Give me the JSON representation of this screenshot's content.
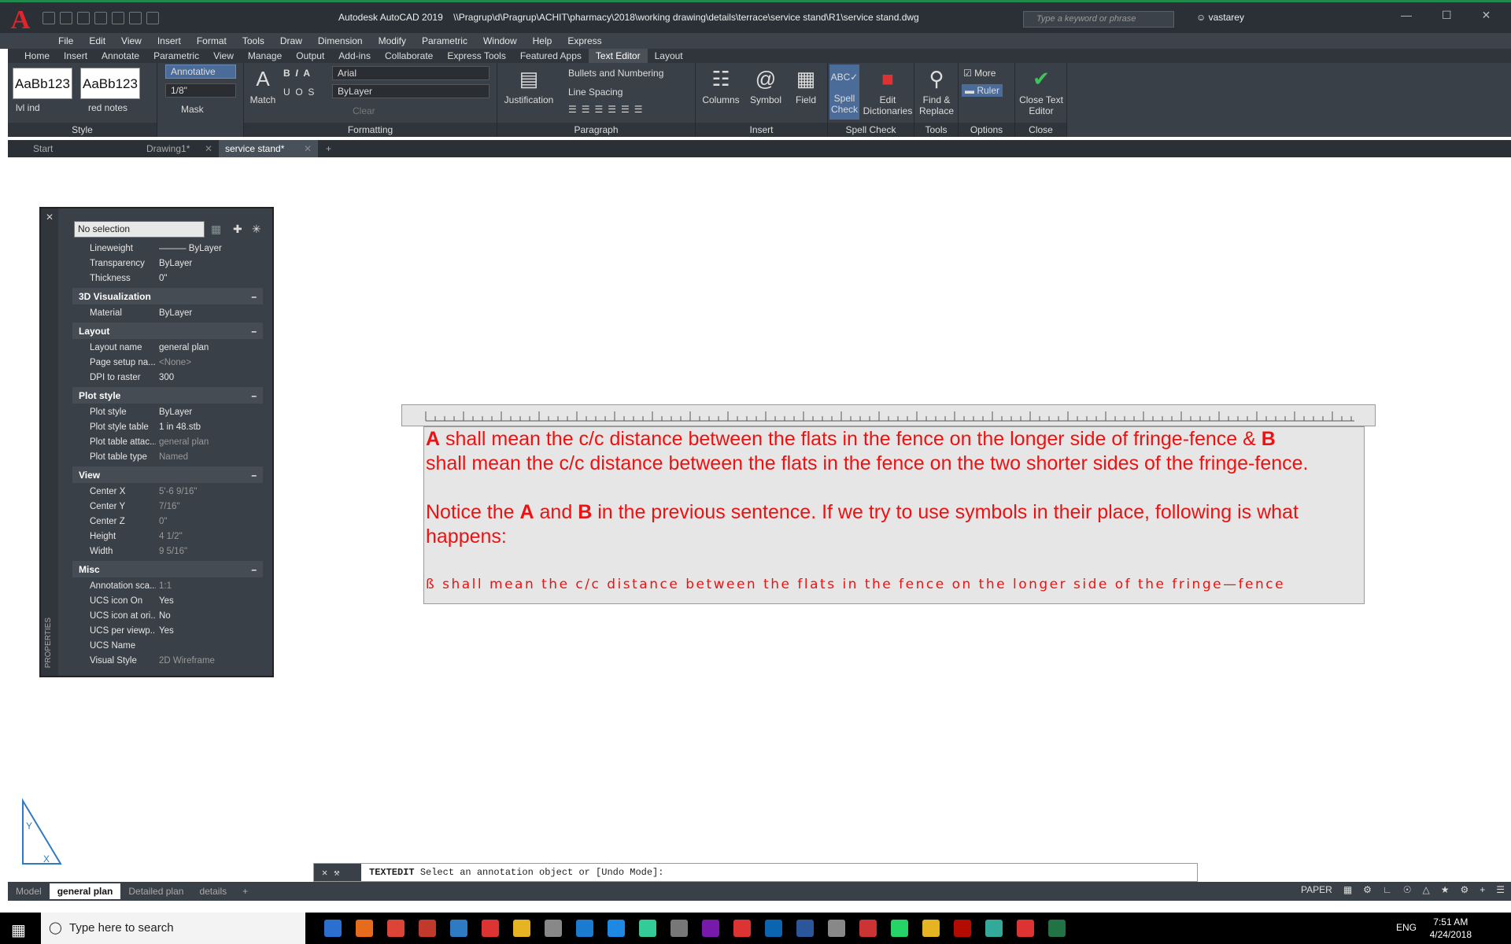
{
  "app": {
    "name": "Autodesk AutoCAD 2019",
    "file_path": "\\\\Pragrup\\d\\Pragrup\\ACHIT\\pharmacy\\2018\\working drawing\\details\\terrace\\service stand\\R1\\service stand.dwg",
    "search_placeholder": "Type a keyword or phrase",
    "user": "vastarey"
  },
  "menu": [
    "File",
    "Edit",
    "View",
    "Insert",
    "Format",
    "Tools",
    "Draw",
    "Dimension",
    "Modify",
    "Parametric",
    "Window",
    "Help",
    "Express"
  ],
  "ribbon_tabs": [
    "Home",
    "Insert",
    "Annotate",
    "Parametric",
    "View",
    "Manage",
    "Output",
    "Add-ins",
    "Collaborate",
    "Express Tools",
    "Featured Apps",
    "Text Editor",
    "Layout"
  ],
  "ribbon_active_tab": "Text Editor",
  "ribbon": {
    "style_panel": {
      "title": "Style",
      "swatch1": "AaBb123",
      "swatch1_label": "lvl ind",
      "swatch2": "AaBb123",
      "swatch2_label": "red notes",
      "annotative": "Annotative",
      "height": "1/8\"",
      "mask": "Mask"
    },
    "formatting_panel": {
      "title": "Formatting",
      "match": "Match",
      "font": "Arial",
      "color": "ByLayer",
      "clear": "Clear"
    },
    "paragraph_panel": {
      "title": "Paragraph",
      "justification": "Justification",
      "bullets": "Bullets and Numbering",
      "line_spacing": "Line Spacing"
    },
    "insert_panel": {
      "title": "Insert",
      "columns": "Columns",
      "symbol": "Symbol",
      "field": "Field"
    },
    "spell_panel": {
      "title": "Spell Check",
      "spell": "Spell Check",
      "edit_dict": "Edit Dictionaries"
    },
    "tools_panel": {
      "title": "Tools",
      "find": "Find & Replace"
    },
    "options_panel": {
      "title": "Options",
      "more": "More",
      "ruler": "Ruler"
    },
    "close_panel": {
      "title": "Close",
      "close": "Close Text Editor"
    }
  },
  "doc_tabs": [
    "Start",
    "Drawing1*",
    "service stand*"
  ],
  "properties": {
    "selection": "No selection",
    "strip_title": "PROPERTIES",
    "rows_top": [
      {
        "k": "Lineweight",
        "v": "——— ByLayer"
      },
      {
        "k": "Transparency",
        "v": "ByLayer"
      },
      {
        "k": "Thickness",
        "v": "0\""
      }
    ],
    "sections": [
      {
        "title": "3D Visualization",
        "rows": [
          {
            "k": "Material",
            "v": "ByLayer"
          }
        ]
      },
      {
        "title": "Layout",
        "rows": [
          {
            "k": "Layout name",
            "v": "general plan"
          },
          {
            "k": "Page setup na...",
            "v": "<None>"
          },
          {
            "k": "DPI to raster",
            "v": "300"
          }
        ]
      },
      {
        "title": "Plot style",
        "rows": [
          {
            "k": "Plot style",
            "v": "ByLayer"
          },
          {
            "k": "Plot style table",
            "v": "1 in 48.stb"
          },
          {
            "k": "Plot table attac...",
            "v": "general plan"
          },
          {
            "k": "Plot table type",
            "v": "Named"
          }
        ]
      },
      {
        "title": "View",
        "rows": [
          {
            "k": "Center X",
            "v": "5'-6 9/16\""
          },
          {
            "k": "Center Y",
            "v": "7/16\""
          },
          {
            "k": "Center Z",
            "v": "0\""
          },
          {
            "k": "Height",
            "v": "4 1/2\""
          },
          {
            "k": "Width",
            "v": "9 5/16\""
          }
        ]
      },
      {
        "title": "Misc",
        "rows": [
          {
            "k": "Annotation sca...",
            "v": "1:1"
          },
          {
            "k": "UCS icon On",
            "v": "Yes"
          },
          {
            "k": "UCS icon at ori...",
            "v": "No"
          },
          {
            "k": "UCS per viewp...",
            "v": "Yes"
          },
          {
            "k": "UCS Name",
            "v": ""
          },
          {
            "k": "Visual Style",
            "v": "2D Wireframe"
          }
        ]
      }
    ]
  },
  "mtext": {
    "l1_a": "A",
    "l1_rest": " shall mean the c/c distance between the flats in the fence on the longer side of fringe-fence & ",
    "l1_b": "B",
    "l2": "shall mean the c/c distance between the flats in the fence on the two shorter sides of the fringe-fence.",
    "l3_pre": "Notice the ",
    "l3_a": "A",
    "l3_mid": " and ",
    "l3_b": "B",
    "l3_post": " in the previous sentence. If we try to use symbols in their place, following is what",
    "l4": "happens:",
    "l5": "ß shall mean the c/c distance between the flats in the fence on the longer side of the fringe—fence"
  },
  "command": {
    "name": "TEXTEDIT",
    "prompt": "Select an annotation object or [Undo Mode]:"
  },
  "layout_tabs": [
    "Model",
    "general plan",
    "Detailed plan",
    "details"
  ],
  "layout_active": "general plan",
  "status": {
    "paper": "PAPER"
  },
  "taskbar": {
    "search": "Type here to search",
    "lang": "ENG",
    "time": "7:51 AM",
    "date": "4/24/2018"
  }
}
